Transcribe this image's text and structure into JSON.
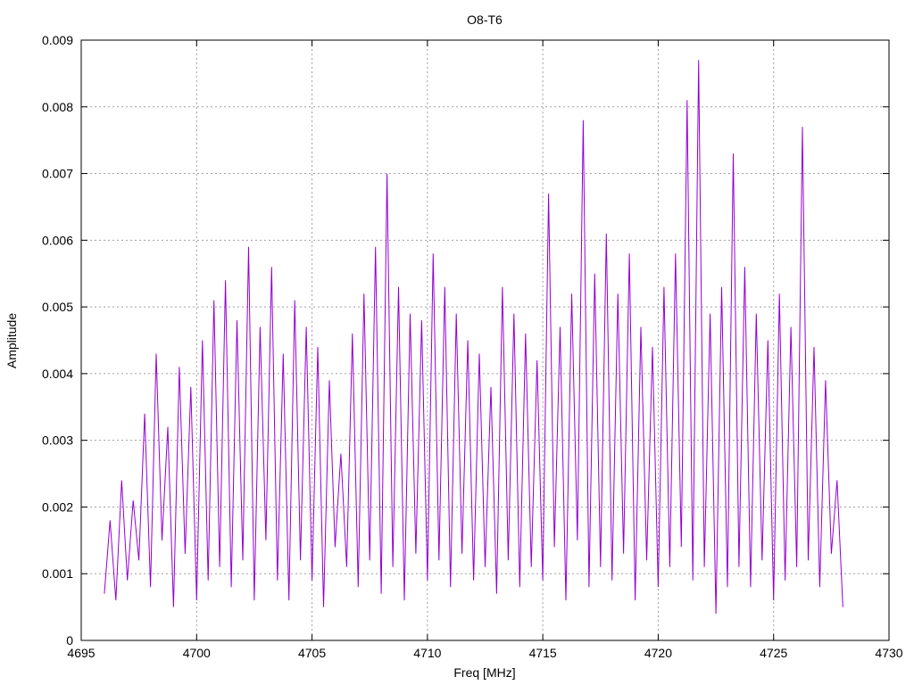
{
  "chart_data": {
    "type": "line",
    "title": "O8-T6",
    "xlabel": "Freq [MHz]",
    "ylabel": "Amplitude",
    "xlim": [
      4695,
      4730
    ],
    "ylim": [
      0,
      0.009
    ],
    "x_ticks": [
      4695,
      4700,
      4705,
      4710,
      4715,
      4720,
      4725,
      4730
    ],
    "x_tick_labels": [
      "4695",
      "4700",
      "4705",
      "4710",
      "4715",
      "4720",
      "4725",
      "4730"
    ],
    "y_ticks": [
      0,
      0.001,
      0.002,
      0.003,
      0.004,
      0.005,
      0.006,
      0.007,
      0.008,
      0.009
    ],
    "y_tick_labels": [
      "0",
      "0.001",
      "0.002",
      "0.003",
      "0.004",
      "0.005",
      "0.006",
      "0.007",
      "0.008",
      "0.009"
    ],
    "grid": true,
    "legend": "none",
    "series": [
      {
        "color": "#9400d3",
        "x": [
          4696.0,
          4696.25,
          4696.5,
          4696.75,
          4697.0,
          4697.25,
          4697.5,
          4697.75,
          4698.0,
          4698.25,
          4698.5,
          4698.75,
          4699.0,
          4699.25,
          4699.5,
          4699.75,
          4700.0,
          4700.25,
          4700.5,
          4700.75,
          4701.0,
          4701.25,
          4701.5,
          4701.75,
          4702.0,
          4702.25,
          4702.5,
          4702.75,
          4703.0,
          4703.25,
          4703.5,
          4703.75,
          4704.0,
          4704.25,
          4704.5,
          4704.75,
          4705.0,
          4705.25,
          4705.5,
          4705.75,
          4706.0,
          4706.25,
          4706.5,
          4706.75,
          4707.0,
          4707.25,
          4707.5,
          4707.75,
          4708.0,
          4708.25,
          4708.5,
          4708.75,
          4709.0,
          4709.25,
          4709.5,
          4709.75,
          4710.0,
          4710.25,
          4710.5,
          4710.75,
          4711.0,
          4711.25,
          4711.5,
          4711.75,
          4712.0,
          4712.25,
          4712.5,
          4712.75,
          4713.0,
          4713.25,
          4713.5,
          4713.75,
          4714.0,
          4714.25,
          4714.5,
          4714.75,
          4715.0,
          4715.25,
          4715.5,
          4715.75,
          4716.0,
          4716.25,
          4716.5,
          4716.75,
          4717.0,
          4717.25,
          4717.5,
          4717.75,
          4718.0,
          4718.25,
          4718.5,
          4718.75,
          4719.0,
          4719.25,
          4719.5,
          4719.75,
          4720.0,
          4720.25,
          4720.5,
          4720.75,
          4721.0,
          4721.25,
          4721.5,
          4721.75,
          4722.0,
          4722.25,
          4722.5,
          4722.75,
          4723.0,
          4723.25,
          4723.5,
          4723.75,
          4724.0,
          4724.25,
          4724.5,
          4724.75,
          4725.0,
          4725.25,
          4725.5,
          4725.75,
          4726.0,
          4726.25,
          4726.5,
          4726.75,
          4727.0,
          4727.25,
          4727.5,
          4727.75,
          4728.0
        ],
        "y": [
          0.0007,
          0.0018,
          0.0006,
          0.0024,
          0.0009,
          0.0021,
          0.0012,
          0.0034,
          0.0008,
          0.0043,
          0.0015,
          0.0032,
          0.0005,
          0.0041,
          0.0013,
          0.0038,
          0.0006,
          0.0045,
          0.0009,
          0.0051,
          0.0011,
          0.0054,
          0.0008,
          0.0048,
          0.0012,
          0.0059,
          0.0006,
          0.0047,
          0.0015,
          0.0056,
          0.0009,
          0.0043,
          0.0006,
          0.0051,
          0.0012,
          0.0047,
          0.0009,
          0.0044,
          0.0005,
          0.0039,
          0.0014,
          0.0028,
          0.0011,
          0.0046,
          0.0008,
          0.0052,
          0.0012,
          0.0059,
          0.0007,
          0.007,
          0.0011,
          0.0053,
          0.0006,
          0.0049,
          0.0013,
          0.0048,
          0.0009,
          0.0058,
          0.0012,
          0.0053,
          0.0008,
          0.0049,
          0.0013,
          0.0045,
          0.0009,
          0.0043,
          0.0011,
          0.0038,
          0.0007,
          0.0053,
          0.0012,
          0.0049,
          0.0008,
          0.0046,
          0.0011,
          0.0042,
          0.0009,
          0.0067,
          0.0014,
          0.0047,
          0.0006,
          0.0052,
          0.0015,
          0.0078,
          0.0008,
          0.0055,
          0.0011,
          0.0061,
          0.0009,
          0.0052,
          0.0013,
          0.0058,
          0.0006,
          0.0047,
          0.0012,
          0.0044,
          0.0008,
          0.0053,
          0.0011,
          0.0058,
          0.0014,
          0.0081,
          0.0009,
          0.0087,
          0.0011,
          0.0049,
          0.0004,
          0.0053,
          0.0008,
          0.0073,
          0.0011,
          0.0056,
          0.0008,
          0.0049,
          0.0012,
          0.0045,
          0.0006,
          0.0052,
          0.0009,
          0.0047,
          0.0011,
          0.0077,
          0.0012,
          0.0044,
          0.0008,
          0.0039,
          0.0013,
          0.0024,
          0.0005
        ]
      }
    ]
  }
}
